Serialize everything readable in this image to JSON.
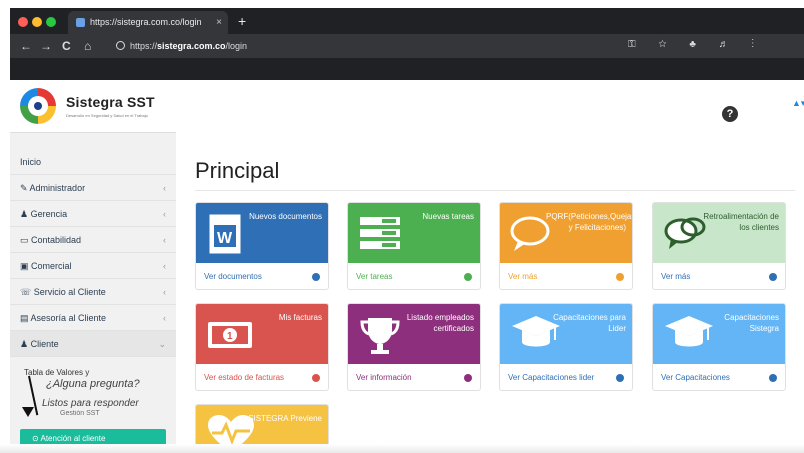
{
  "browser": {
    "tab_title": "https://sistegra.com.co/login",
    "tab_close": "×",
    "new_tab": "+",
    "url_prefix": "https://",
    "url_host": "sistegra.com.co",
    "url_path": "/login",
    "nav": {
      "back": "←",
      "forward": "→",
      "reload": "C",
      "home": "⌂"
    }
  },
  "header": {
    "brand": "Sistegra SST",
    "brand_sub": "Desarrollo en Seguridad y Salud en el Trabajo",
    "help": "?",
    "user": "▲▾"
  },
  "sidebar": {
    "items": [
      {
        "label": "Inicio",
        "icon": "home-icon",
        "chevron": ""
      },
      {
        "label": "Administrador",
        "icon": "wrench-icon",
        "chevron": "‹"
      },
      {
        "label": "Gerencia",
        "icon": "users-icon",
        "chevron": "‹"
      },
      {
        "label": "Contabilidad",
        "icon": "chart-icon",
        "chevron": "‹"
      },
      {
        "label": "Comercial",
        "icon": "briefcase-icon",
        "chevron": "‹"
      },
      {
        "label": "Servicio al Cliente",
        "icon": "headset-icon",
        "chevron": "‹"
      },
      {
        "label": "Asesoría al Cliente",
        "icon": "book-icon",
        "chevron": "‹"
      },
      {
        "label": "Cliente",
        "icon": "users-icon",
        "chevron": "⌄"
      }
    ],
    "sub_item": "Tabla de Valores y",
    "overlay_question": "¿Alguna pregunta?",
    "overlay_ready": "Listos para responder",
    "sub_item_hidden": "Gestión SST",
    "green_button": "Atención al cliente"
  },
  "main": {
    "title": "Principal",
    "cards": [
      {
        "label": "Nuevos documentos",
        "footer": "Ver documentos",
        "color": "#2f6fb5",
        "icon": "word-document-icon"
      },
      {
        "label": "Nuevas tareas",
        "footer": "Ver tareas",
        "color": "#4caf50",
        "icon": "list-icon"
      },
      {
        "label": "PQRF(Peticiones,Quejas,Reclamaciones y Felicitaciones)",
        "footer": "Ver más",
        "color": "#f0a030",
        "icon": "speech-bubble-icon"
      },
      {
        "label": "Retroalimentación de los clientes",
        "footer": "Ver más",
        "color": "#c8e6c9",
        "icon": "chat-bubbles-icon"
      },
      {
        "label": "Mis facturas",
        "footer": "Ver estado de facturas",
        "color": "#d9534f",
        "icon": "money-icon"
      },
      {
        "label": "Listado empleados certificados",
        "footer": "Ver información",
        "color": "#8e2f7e",
        "icon": "trophy-icon"
      },
      {
        "label": "Capacitaciones para Lider",
        "footer": "Ver Capacitaciones lider",
        "color": "#64b5f6",
        "icon": "graduation-cap-icon"
      },
      {
        "label": "Capacitaciones Sistegra",
        "footer": "Ver Capacitaciones",
        "color": "#64b5f6",
        "icon": "graduation-cap-icon"
      },
      {
        "label": "SISTEGRA Previene",
        "footer": "",
        "color": "#f5c242",
        "icon": "heartbeat-icon"
      }
    ]
  }
}
